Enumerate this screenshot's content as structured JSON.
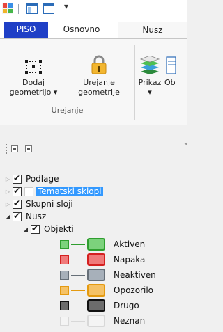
{
  "qat": {
    "icons": [
      "app-icon",
      "window-icon",
      "panel-icon",
      "customize-dropdown-icon"
    ],
    "dropdown_glyph": "▾"
  },
  "tabs": [
    {
      "label": "PISO",
      "active": false
    },
    {
      "label": "Osnovno",
      "active": false
    },
    {
      "label": "Nusz",
      "active": true
    }
  ],
  "ribbon": {
    "buttons": [
      {
        "line1": "Dodaj",
        "line2": "geometrijo ▾",
        "icon": "add-geometry-icon"
      },
      {
        "line1": "Urejanje",
        "line2": "geometrije",
        "icon": "lock-icon"
      },
      {
        "line1": "Prikaz",
        "line2": "▾",
        "icon": "layers-icon"
      },
      {
        "line1": "Ob",
        "line2": "",
        "icon": "document-icon"
      }
    ],
    "group_label": "Urejanje"
  },
  "tree": {
    "items": [
      {
        "label": "Podlage",
        "checked": true,
        "expanded": false,
        "level": 0
      },
      {
        "label": "Tematski sklopi",
        "checked": true,
        "expanded": false,
        "level": 0,
        "selected": true
      },
      {
        "label": "Skupni sloji",
        "checked": true,
        "expanded": false,
        "level": 0
      },
      {
        "label": "Nusz",
        "checked": true,
        "expanded": true,
        "level": 0
      },
      {
        "label": "Objekti",
        "checked": true,
        "expanded": true,
        "level": 1
      }
    ],
    "legend": [
      {
        "label": "Aktiven",
        "border": "#2f9e2f",
        "fill": "#7cd27c"
      },
      {
        "label": "Napaka",
        "border": "#d42020",
        "fill": "#f07a7a"
      },
      {
        "label": "Neaktiven",
        "border": "#666f78",
        "fill": "#a7b0ba"
      },
      {
        "label": "Opozorilo",
        "border": "#e49a10",
        "fill": "#f5c266"
      },
      {
        "label": "Drugo",
        "border": "#111111",
        "fill": "#6c6c6c"
      },
      {
        "label": "Neznan",
        "border": "#d8d8d8",
        "fill": "#f4f4f4"
      }
    ]
  }
}
